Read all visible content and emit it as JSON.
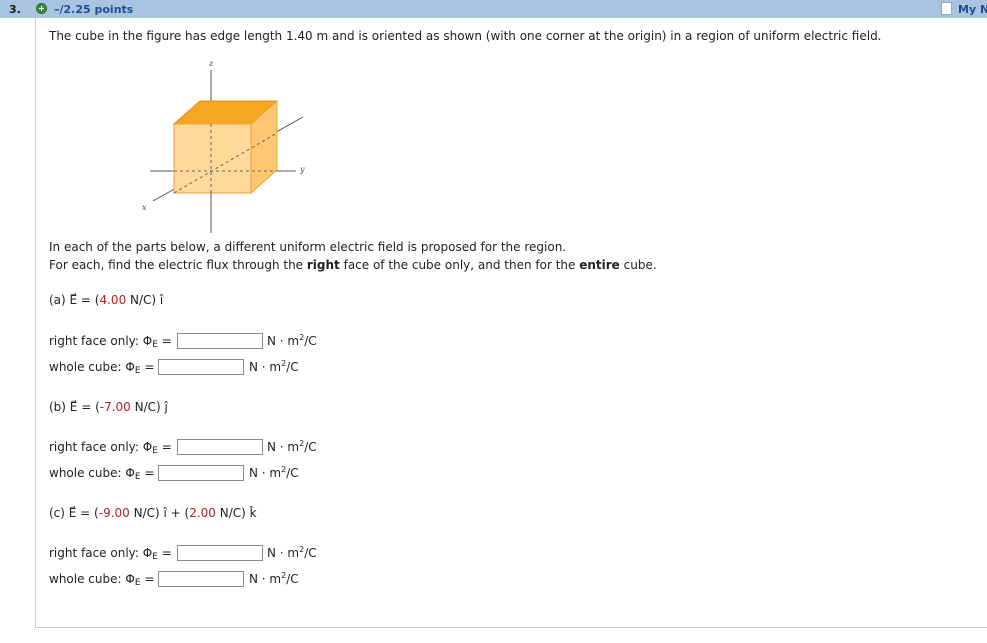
{
  "header": {
    "question_number": "3.",
    "points": "–/2.25 points",
    "my_notes": "My Notes"
  },
  "problem": {
    "statement": "The cube in the figure has edge length 1.40 m and is oriented as shown (with one corner at the origin) in a region of uniform electric field.",
    "instructions_1": "In each of the parts below, a different uniform electric field is proposed for the region.",
    "instructions_2_pre": "For each, find the electric flux through the ",
    "instructions_2_bold1": "right",
    "instructions_2_mid": " face of the cube only, and then for the ",
    "instructions_2_bold2": "entire",
    "instructions_2_post": " cube."
  },
  "figure": {
    "axis_labels": {
      "z": "z",
      "y": "y",
      "x": "x"
    }
  },
  "labels": {
    "right_face": "right face only: Φ",
    "whole_cube": "whole cube: Φ",
    "phi_sub": "E",
    "eq": "=",
    "unit_pre": "N · m",
    "unit_sup": "2",
    "unit_post": "/C"
  },
  "parts": [
    {
      "letter": "(a)",
      "field_pre": " E⃗ = (",
      "value1": "4.00",
      "unit1": " N/C) î",
      "value2": "",
      "unit2": ""
    },
    {
      "letter": "(b)",
      "field_pre": " E⃗ = (",
      "value1": "-7.00",
      "unit1": " N/C)  ĵ",
      "value2": "",
      "unit2": ""
    },
    {
      "letter": "(c)",
      "field_pre": " E⃗ = (",
      "value1": "-9.00",
      "unit1": " N/C) î + (",
      "value2": "2.00",
      "unit2": " N/C) k̂"
    }
  ],
  "answers": {
    "a_right": "",
    "a_whole": "",
    "b_right": "",
    "b_whole": "",
    "c_right": "",
    "c_whole": ""
  },
  "colors": {
    "header_bg": "#a8c4e0",
    "link_blue": "#1f4f8f",
    "value_red": "#b22222",
    "cube_top": "#f5a623",
    "cube_front": "#ffd99a"
  }
}
